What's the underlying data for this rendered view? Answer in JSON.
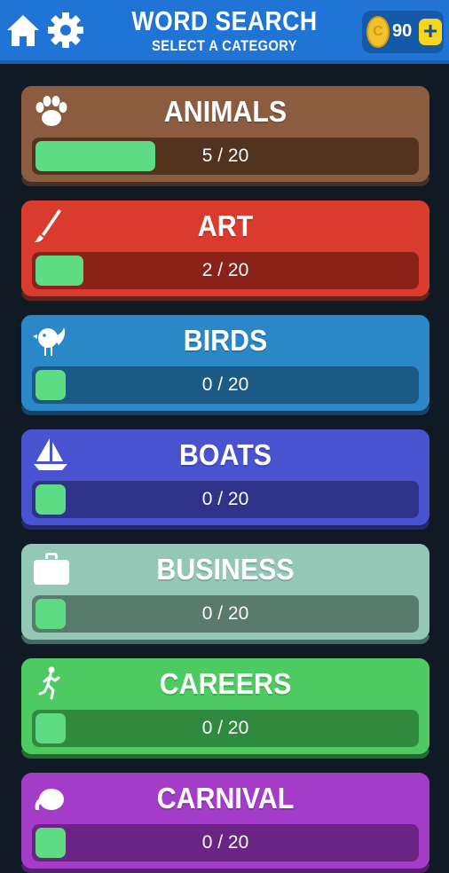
{
  "header": {
    "title": "WORD SEARCH",
    "subtitle": "SELECT A CATEGORY",
    "coins": "90",
    "coin_symbol": "C",
    "plus_symbol": "+",
    "icons": [
      "home-icon",
      "gear-icon",
      "coin-icon",
      "plus-icon"
    ]
  },
  "categories": [
    {
      "name": "ANIMALS",
      "progress_text": "5 / 20",
      "progress": 0.25,
      "icon": "paw-icon",
      "color": "#8b5c3f",
      "shadow": "#5a3a27",
      "track": "#52331f"
    },
    {
      "name": "ART",
      "progress_text": "2 / 20",
      "progress": 0.1,
      "icon": "paintbrush-icon",
      "color": "#d93c2c",
      "shadow": "#8c241a",
      "track": "#8a2219"
    },
    {
      "name": "BIRDS",
      "progress_text": "0 / 20",
      "progress": 0,
      "icon": "bird-icon",
      "color": "#2a87c8",
      "shadow": "#1a5784",
      "track": "#1c5a86"
    },
    {
      "name": "BOATS",
      "progress_text": "0 / 20",
      "progress": 0,
      "icon": "sailboat-icon",
      "color": "#4952cf",
      "shadow": "#2d338a",
      "track": "#2e3289"
    },
    {
      "name": "BUSINESS",
      "progress_text": "0 / 20",
      "progress": 0,
      "icon": "briefcase-icon",
      "color": "#93c8b6",
      "shadow": "#5e8a7a",
      "track": "#5b7a6e"
    },
    {
      "name": "CAREERS",
      "progress_text": "0 / 20",
      "progress": 0,
      "icon": "runner-icon",
      "color": "#4dca61",
      "shadow": "#2e8a3d",
      "track": "#2f8a3f"
    },
    {
      "name": "CARNIVAL",
      "progress_text": "0 / 20",
      "progress": 0,
      "icon": "elephant-icon",
      "color": "#a43bc9",
      "shadow": "#6c2386",
      "track": "#6a2484"
    }
  ]
}
